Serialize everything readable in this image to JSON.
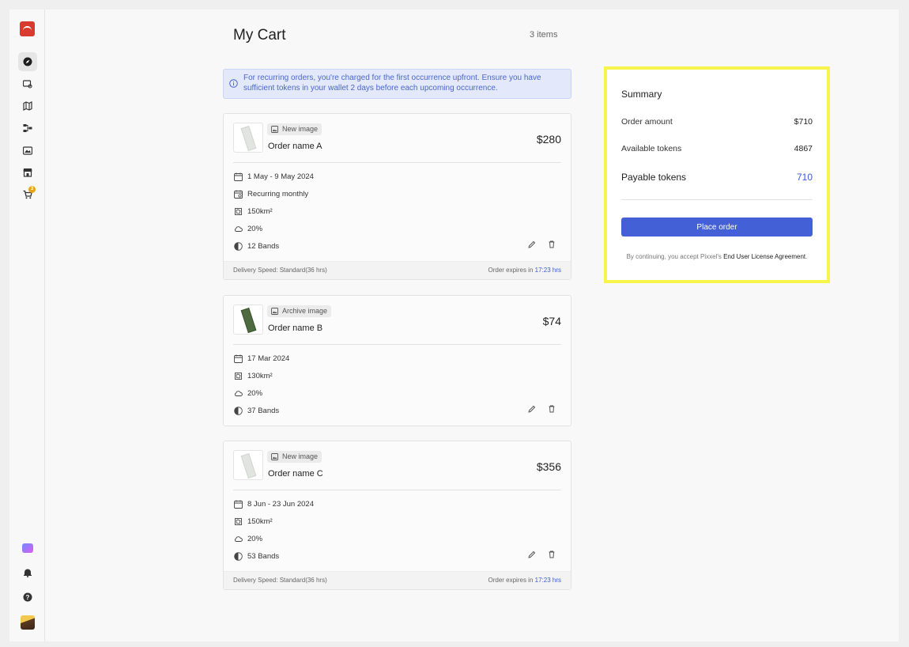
{
  "header": {
    "title": "My Cart",
    "count": "3 items"
  },
  "info_banner": "For recurring orders, you're charged for the first occurrence upfront. Ensure you have sufficient tokens in your wallet 2 days before each upcoming occurrence.",
  "sidebar": {
    "cart_badge": "3"
  },
  "orders": [
    {
      "tag": "New image",
      "name": "Order name A",
      "price": "$280",
      "date": "1 May - 9 May 2024",
      "recurrence": "Recurring monthly",
      "area": "150km²",
      "cloud": "20%",
      "bands": "12 Bands",
      "delivery_label": "Delivery Speed:",
      "delivery_value": "Standard(36 hrs)",
      "expires_label": "Order expires in",
      "expires_value": "17:23 hrs"
    },
    {
      "tag": "Archive image",
      "name": "Order name B",
      "price": "$74",
      "date": "17 Mar 2024",
      "area": "130km²",
      "cloud": "20%",
      "bands": "37 Bands"
    },
    {
      "tag": "New image",
      "name": "Order name C",
      "price": "$356",
      "date": "8 Jun - 23 Jun 2024",
      "area": "150km²",
      "cloud": "20%",
      "bands": "53 Bands",
      "delivery_label": "Delivery Speed:",
      "delivery_value": "Standard(36 hrs)",
      "expires_label": "Order expires in",
      "expires_value": "17:23 hrs"
    }
  ],
  "summary": {
    "title": "Summary",
    "order_amount_label": "Order amount",
    "order_amount_value": "$710",
    "available_tokens_label": "Available tokens",
    "available_tokens_value": "4867",
    "payable_tokens_label": "Payable tokens",
    "payable_tokens_value": "710",
    "place_order": "Place order",
    "legal_prefix": "By continuing, you accept Pixxel's",
    "legal_link": "End User License Agreement",
    "legal_suffix": "."
  }
}
